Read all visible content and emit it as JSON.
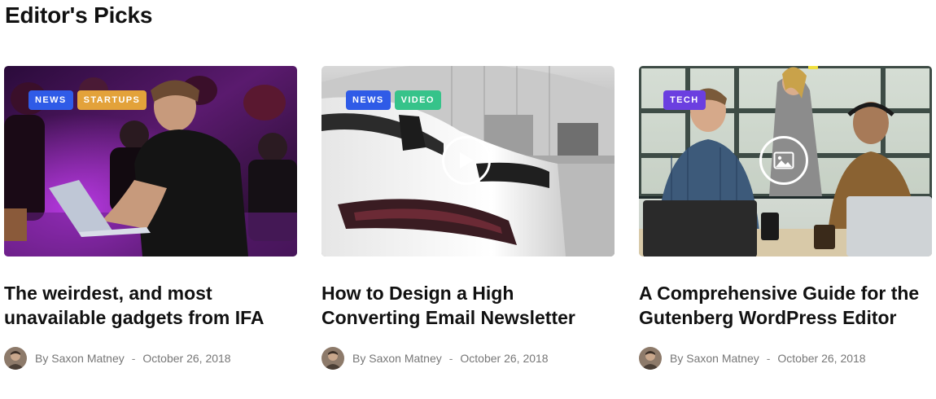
{
  "section": {
    "title": "Editor's Picks"
  },
  "colors": {
    "news": "#2f5be7",
    "startups": "#e3a23a",
    "video": "#36c38a",
    "tech": "#6b3fe0"
  },
  "cards": [
    {
      "tags": [
        {
          "label": "NEWS",
          "color": "#2f5be7"
        },
        {
          "label": "STARTUPS",
          "color": "#e3a23a"
        }
      ],
      "media_icon": null,
      "image_icon": "conference-laptop-photo",
      "title": "The weirdest, and most unavailable gadgets from IFA",
      "author": "By Saxon Matney",
      "separator": "-",
      "date": "October 26, 2018"
    },
    {
      "tags": [
        {
          "label": "NEWS",
          "color": "#2f5be7"
        },
        {
          "label": "VIDEO",
          "color": "#36c38a"
        }
      ],
      "media_icon": "play-icon",
      "image_icon": "car-taillight-photo",
      "title": "How to Design a High Converting Email Newsletter",
      "author": "By Saxon Matney",
      "separator": "-",
      "date": "October 26, 2018"
    },
    {
      "tags": [
        {
          "label": "TECH",
          "color": "#6b3fe0"
        }
      ],
      "media_icon": "image-icon",
      "image_icon": "office-team-photo",
      "title": "A Comprehensive Guide for the Gutenberg WordPress Editor",
      "author": "By Saxon Matney",
      "separator": "-",
      "date": "October 26, 2018"
    }
  ]
}
